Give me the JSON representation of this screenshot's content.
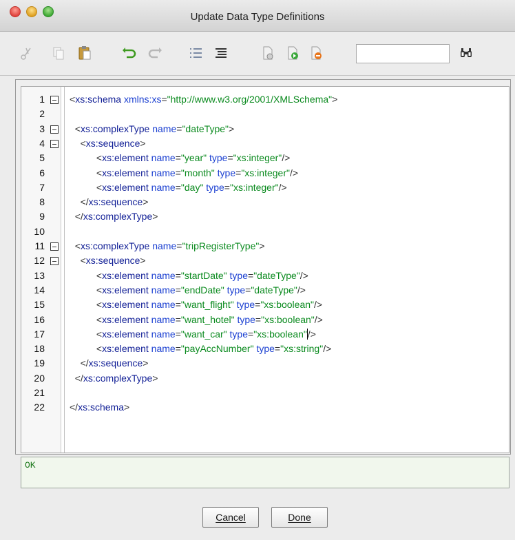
{
  "window": {
    "title": "Update Data Type Definitions"
  },
  "toolbar": {
    "icons": [
      "cut-icon",
      "copy-icon",
      "paste-icon",
      "undo-icon",
      "redo-icon",
      "numbered-list-icon",
      "format-icon",
      "document-icon",
      "document-export-icon",
      "document-stop-icon",
      "find-icon"
    ],
    "search_value": ""
  },
  "editor": {
    "line_numbers": [
      "1",
      "2",
      "3",
      "4",
      "5",
      "6",
      "7",
      "8",
      "9",
      "10",
      "11",
      "12",
      "13",
      "14",
      "15",
      "16",
      "17",
      "18",
      "19",
      "20",
      "21",
      "22"
    ],
    "lines": [
      "<xs:schema xmlns:xs=\"http://www.w3.org/2001/XMLSchema\">",
      "",
      "  <xs:complexType name=\"dateType\">",
      "    <xs:sequence>",
      "          <xs:element name=\"year\" type=\"xs:integer\"/>",
      "          <xs:element name=\"month\" type=\"xs:integer\"/>",
      "          <xs:element name=\"day\" type=\"xs:integer\"/>",
      "    </xs:sequence>",
      "  </xs:complexType>",
      "",
      "  <xs:complexType name=\"tripRegisterType\">",
      "    <xs:sequence>",
      "          <xs:element name=\"startDate\" type=\"dateType\"/>",
      "          <xs:element name=\"endDate\" type=\"dateType\"/>",
      "          <xs:element name=\"want_flight\" type=\"xs:boolean\"/>",
      "          <xs:element name=\"want_hotel\" type=\"xs:boolean\"/>",
      "          <xs:element name=\"want_car\" type=\"xs:boolean\"/>",
      "          <xs:element name=\"payAccNumber\" type=\"xs:string\"/>",
      "    </xs:sequence>",
      "  </xs:complexType>",
      "",
      "</xs:schema>"
    ],
    "fold_lines": [
      1,
      3,
      4,
      11,
      12
    ],
    "caret_line": 17
  },
  "status": {
    "text": "OK"
  },
  "buttons": {
    "cancel": "Cancel",
    "done": "Done"
  }
}
